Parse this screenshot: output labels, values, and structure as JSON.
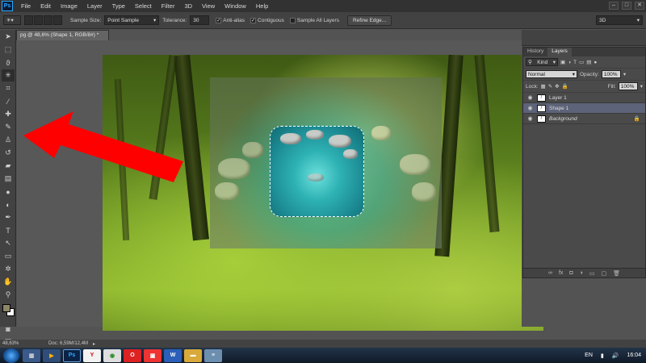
{
  "app": {
    "logo": "Ps"
  },
  "menu": [
    "File",
    "Edit",
    "Image",
    "Layer",
    "Type",
    "Select",
    "Filter",
    "3D",
    "View",
    "Window",
    "Help"
  ],
  "window_controls": [
    "minimize-icon",
    "restore-icon",
    "close-icon"
  ],
  "options": {
    "sample_size_label": "Sample Size:",
    "sample_size_value": "Point Sample",
    "tolerance_label": "Tolerance:",
    "tolerance_value": "30",
    "anti_alias": "Anti-alias",
    "contiguous": "Contiguous",
    "sample_all_layers": "Sample All Layers",
    "refine_edge": "Refine Edge...",
    "workspace": "3D"
  },
  "document": {
    "tab_title": "pg @ 48,6% (Shape 1, RGB/8#) *"
  },
  "panel": {
    "tabs": [
      "History",
      "Layers"
    ],
    "kind": "Kind",
    "blend_mode": "Normal",
    "opacity_label": "Opacity:",
    "opacity_value": "100%",
    "lock_label": "Lock:",
    "fill_label": "Fill:",
    "fill_value": "100%",
    "layers": [
      {
        "name": "Layer 1",
        "selected": false
      },
      {
        "name": "Shape 1",
        "selected": true
      },
      {
        "name": "Background",
        "selected": false
      }
    ],
    "footer_icons": [
      "link-icon",
      "fx-icon",
      "mask-icon",
      "adjustment-icon",
      "group-icon",
      "new-layer-icon",
      "trash-icon"
    ]
  },
  "status": {
    "zoom": "48,63%",
    "doc": "Doc: 6,59M/12,4M"
  },
  "taskbar": {
    "language": "EN",
    "time": "16:04",
    "items": [
      "explorer-icon",
      "media-icon",
      "photoshop-icon",
      "yandex-icon",
      "chrome-icon",
      "opera-icon",
      "app-icon",
      "word-icon",
      "folder-icon",
      "notes-icon"
    ]
  },
  "colors": {
    "arrow": "#ff0000",
    "selected_layer": "#5d6378",
    "accent": "#31a8ff"
  }
}
